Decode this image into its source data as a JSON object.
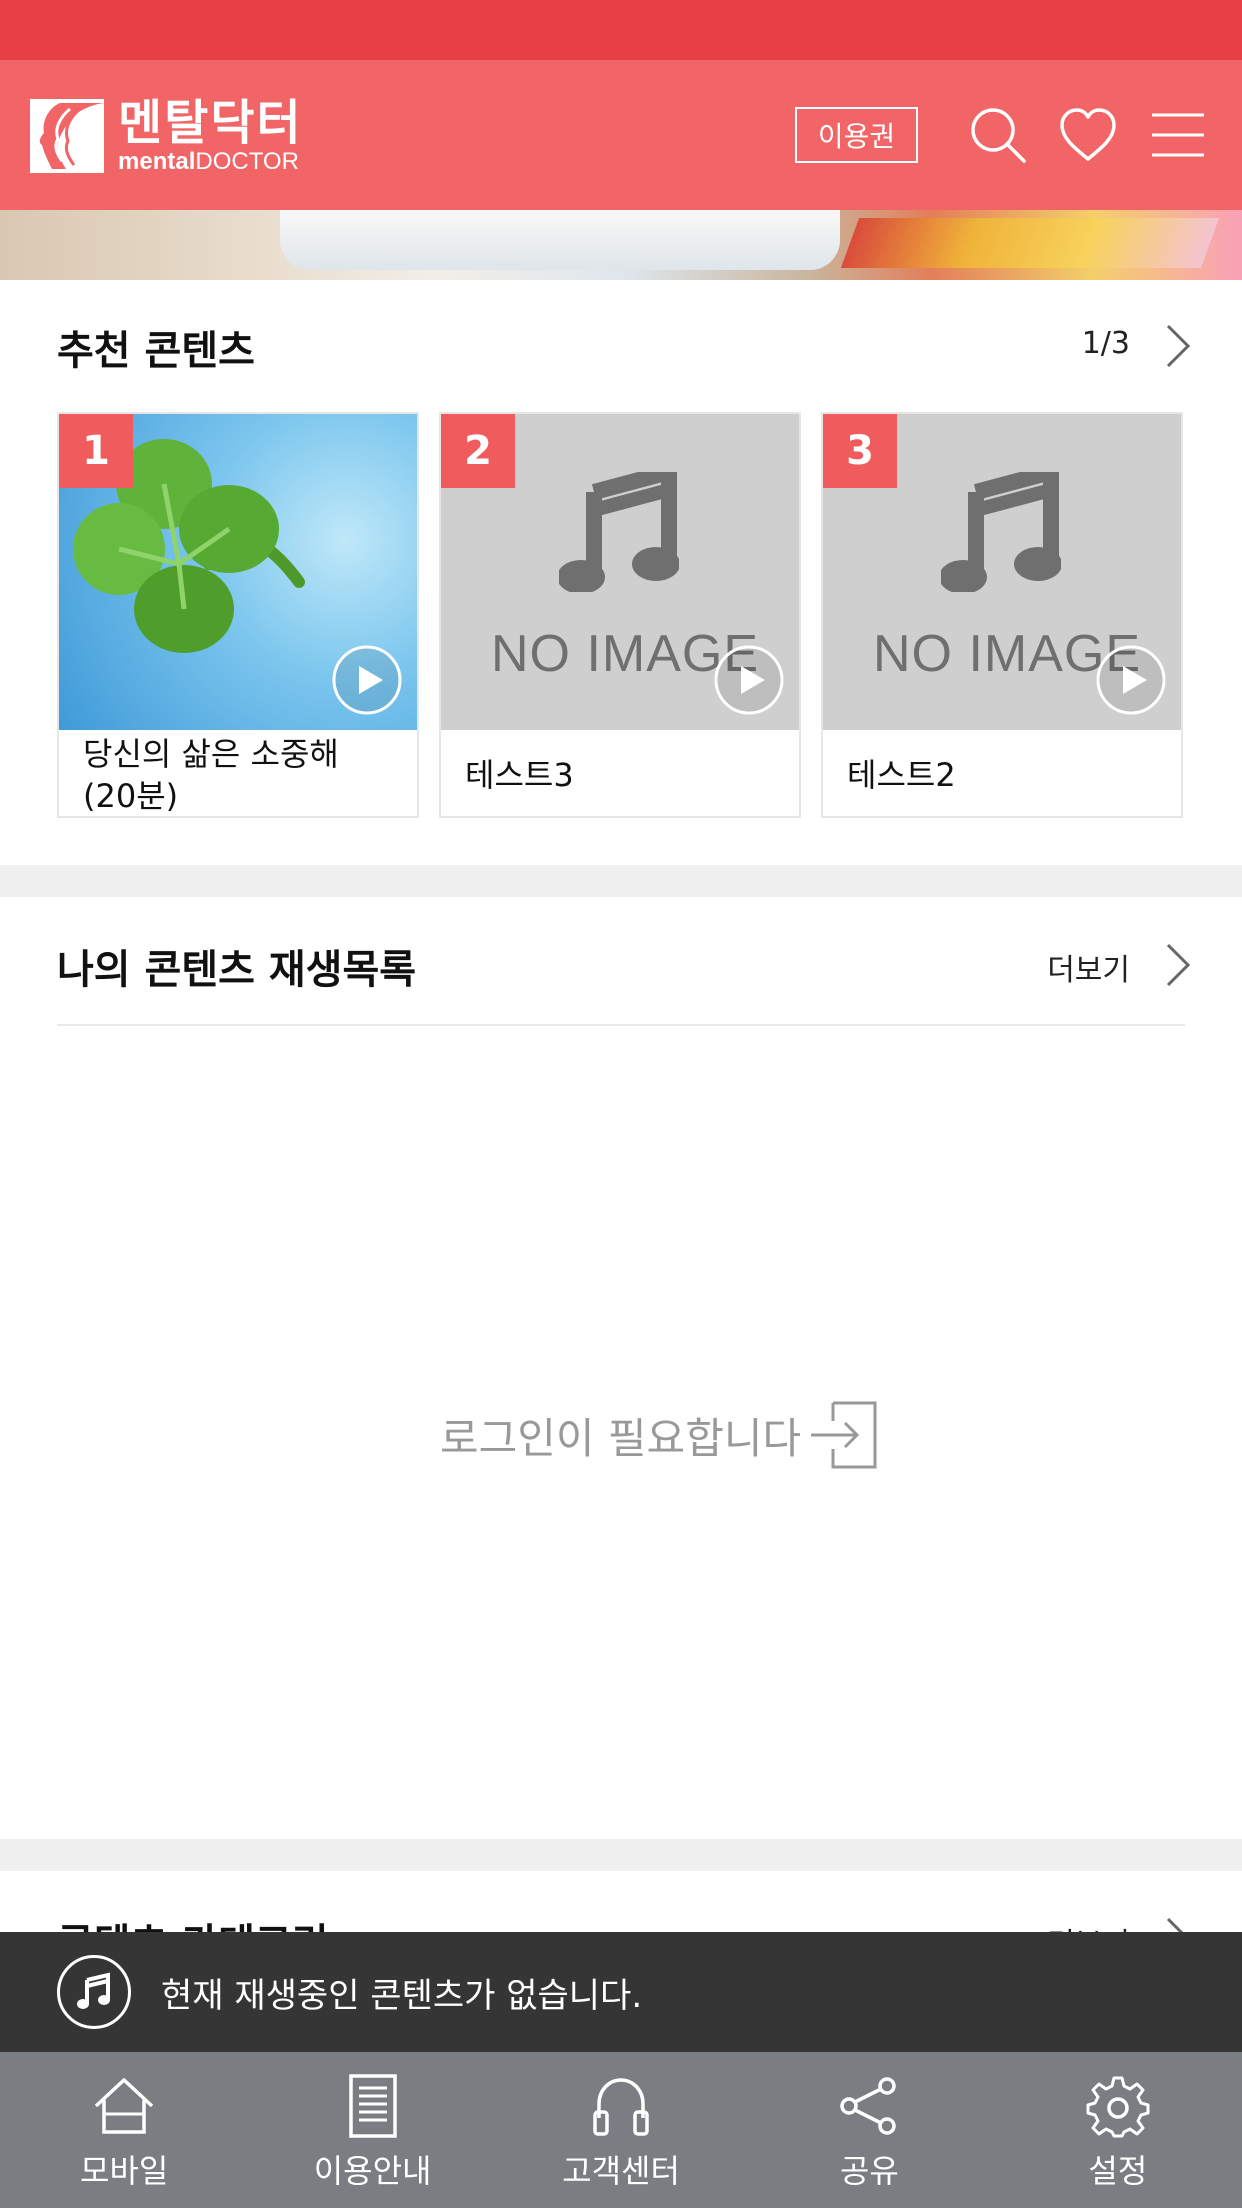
{
  "header": {
    "logo_ko": "멘탈닥터",
    "logo_en_bold": "mental",
    "logo_en_rest": "DOCTOR",
    "ticket_label": "이용권"
  },
  "recommended": {
    "title": "추천 콘텐츠",
    "pager": "1/3",
    "cards": [
      {
        "rank": "1",
        "title": "당신의 삶은 소중해 (20분)",
        "image": "clover"
      },
      {
        "rank": "2",
        "title": "테스트3",
        "image": "no-image"
      },
      {
        "rank": "3",
        "title": "테스트2",
        "image": "no-image"
      }
    ],
    "no_image_text": "NO IMAGE"
  },
  "playlist": {
    "title": "나의 콘텐츠 재생목록",
    "more_label": "더보기",
    "login_required": "로그인이 필요합니다"
  },
  "category": {
    "title": "콘텐츠 카테고리",
    "more_label": "더보기"
  },
  "player": {
    "status_text": "현재 재생중인 콘텐츠가 없습니다."
  },
  "tabbar": {
    "items": [
      {
        "label": "모바일",
        "icon": "home-icon"
      },
      {
        "label": "이용안내",
        "icon": "document-icon"
      },
      {
        "label": "고객센터",
        "icon": "headphones-icon"
      },
      {
        "label": "공유",
        "icon": "share-icon"
      },
      {
        "label": "설정",
        "icon": "gear-icon"
      }
    ]
  },
  "colors": {
    "status_bar": "#e83e45",
    "header": "#f26567",
    "rank_badge": "#f05c5e",
    "player_bar": "#353535",
    "tab_bar": "#7a7e82"
  }
}
